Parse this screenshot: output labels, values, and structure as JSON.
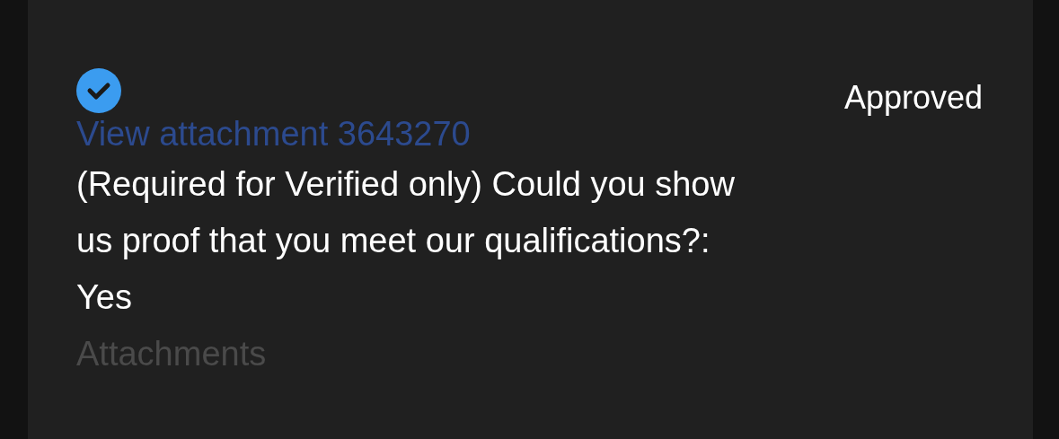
{
  "item": {
    "approved": true,
    "status": "Approved",
    "link": "View attachment 3643270",
    "question": "(Required for Verified only) Could you show us proof that you meet our qualifications?:",
    "answer": "Yes",
    "next_heading": "Attachments"
  }
}
